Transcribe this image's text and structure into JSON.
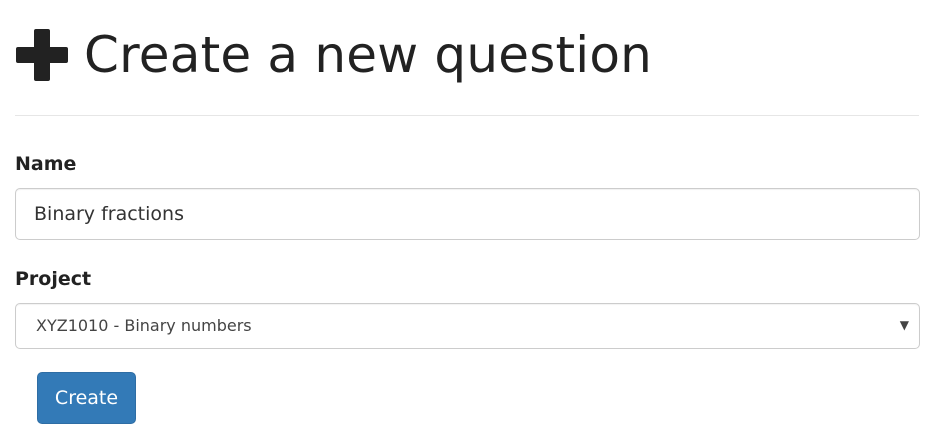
{
  "header": {
    "icon": "plus-icon",
    "title": "Create a new question"
  },
  "form": {
    "name_label": "Name",
    "name_value": "Binary fractions",
    "project_label": "Project",
    "project_selected": "XYZ1010 - Binary numbers",
    "dropdown_icon": "caret-down-icon",
    "create_label": "Create"
  },
  "colors": {
    "primary_button": "#337ab7",
    "text": "#222222",
    "border": "#cccccc"
  }
}
